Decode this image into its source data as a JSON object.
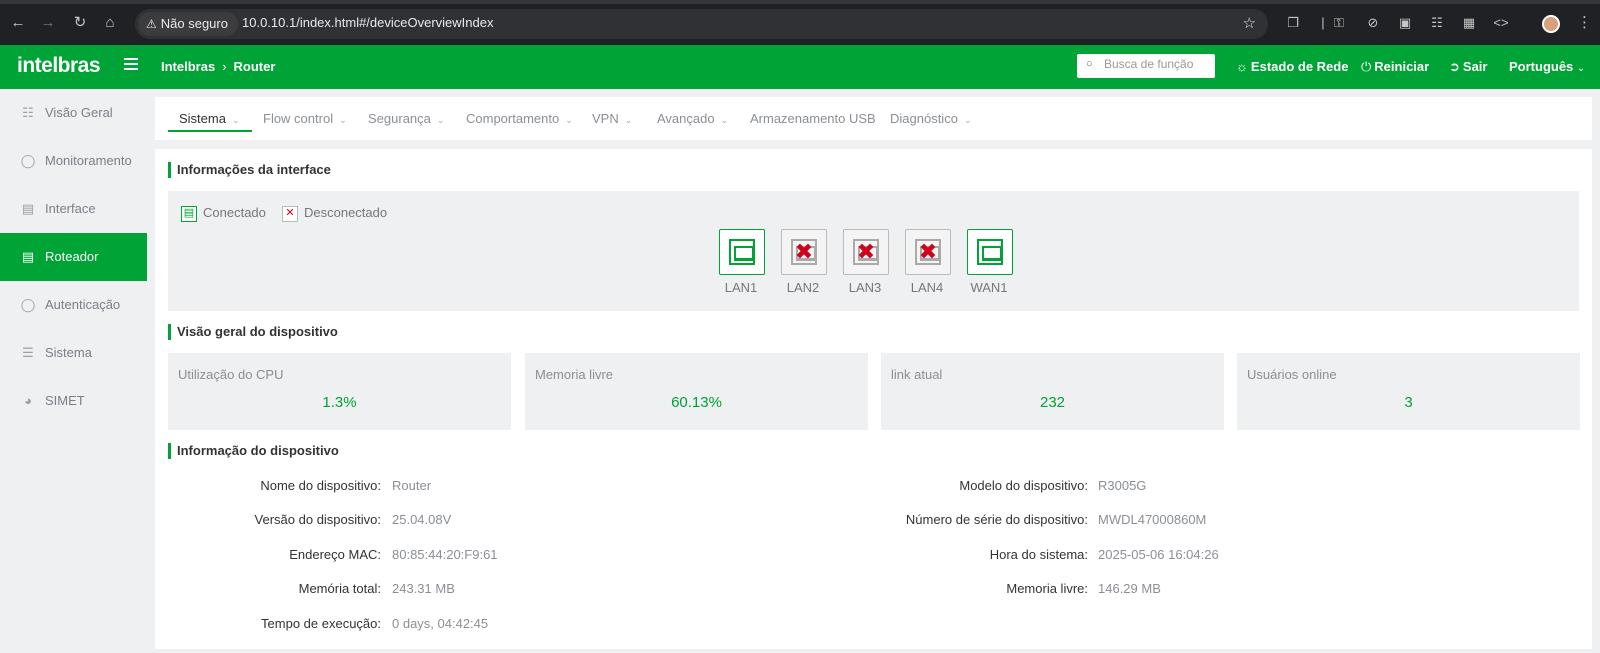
{
  "browser": {
    "security_label": "Não seguro",
    "url": "10.0.10.1/index.html#/deviceOverviewIndex"
  },
  "header": {
    "logo": "intelbras",
    "breadcrumb": [
      "Intelbras",
      "Router"
    ],
    "search_placeholder": "Busca de função",
    "actions": {
      "network_status": "Estado de Rede",
      "restart": "Reiniciar",
      "logout": "Sair",
      "language": "Português"
    }
  },
  "sidebar": {
    "items": [
      {
        "label": "Visão Geral",
        "icon": "sitemap-icon"
      },
      {
        "label": "Monitoramento",
        "icon": "user-circle-icon"
      },
      {
        "label": "Interface",
        "icon": "network-port-icon"
      },
      {
        "label": "Roteador",
        "icon": "router-icon"
      },
      {
        "label": "Autenticação",
        "icon": "shield-icon"
      },
      {
        "label": "Sistema",
        "icon": "sliders-icon"
      },
      {
        "label": "SIMET",
        "icon": "speedometer-icon"
      }
    ],
    "active_index": 3
  },
  "tabs": [
    {
      "label": "Sistema",
      "dropdown": true
    },
    {
      "label": "Flow control",
      "dropdown": true
    },
    {
      "label": "Segurança",
      "dropdown": true
    },
    {
      "label": "Comportamento",
      "dropdown": true
    },
    {
      "label": "VPN",
      "dropdown": true
    },
    {
      "label": "Avançado",
      "dropdown": true
    },
    {
      "label": "Armazenamento USB",
      "dropdown": false
    },
    {
      "label": "Diagnóstico",
      "dropdown": true
    }
  ],
  "interface_info": {
    "title": "Informações da interface",
    "legend": {
      "connected": "Conectado",
      "disconnected": "Desconectado"
    },
    "ports": [
      {
        "name": "LAN1",
        "connected": true
      },
      {
        "name": "LAN2",
        "connected": false
      },
      {
        "name": "LAN3",
        "connected": false
      },
      {
        "name": "LAN4",
        "connected": false
      },
      {
        "name": "WAN1",
        "connected": true
      }
    ]
  },
  "device_overview": {
    "title": "Visão geral do dispositivo",
    "stats": [
      {
        "label": "Utilização do CPU",
        "value": "1.3%"
      },
      {
        "label": "Memoria livre",
        "value": "60.13%"
      },
      {
        "label": "link atual",
        "value": "232"
      },
      {
        "label": "Usuários online",
        "value": "3"
      }
    ]
  },
  "device_info": {
    "title": "Informação do dispositivo",
    "left": [
      {
        "label": "Nome do dispositivo:",
        "value": "Router"
      },
      {
        "label": "Versão do dispositivo:",
        "value": "25.04.08V"
      },
      {
        "label": "Endereço MAC:",
        "value": "80:85:44:20:F9:61"
      },
      {
        "label": "Memória total:",
        "value": "243.31 MB"
      },
      {
        "label": "Tempo de execução:",
        "value": "0 days, 04:42:45"
      }
    ],
    "right": [
      {
        "label": "Modelo do dispositivo:",
        "value": "R3005G"
      },
      {
        "label": "Número de série do dispositivo:",
        "value": "MWDL47000860M"
      },
      {
        "label": "Hora do sistema:",
        "value": "2025-05-06 16:04:26"
      },
      {
        "label": "Memoria livre:",
        "value": "146.29 MB"
      }
    ]
  },
  "colors": {
    "brand": "#00a335",
    "error": "#d0021b"
  }
}
